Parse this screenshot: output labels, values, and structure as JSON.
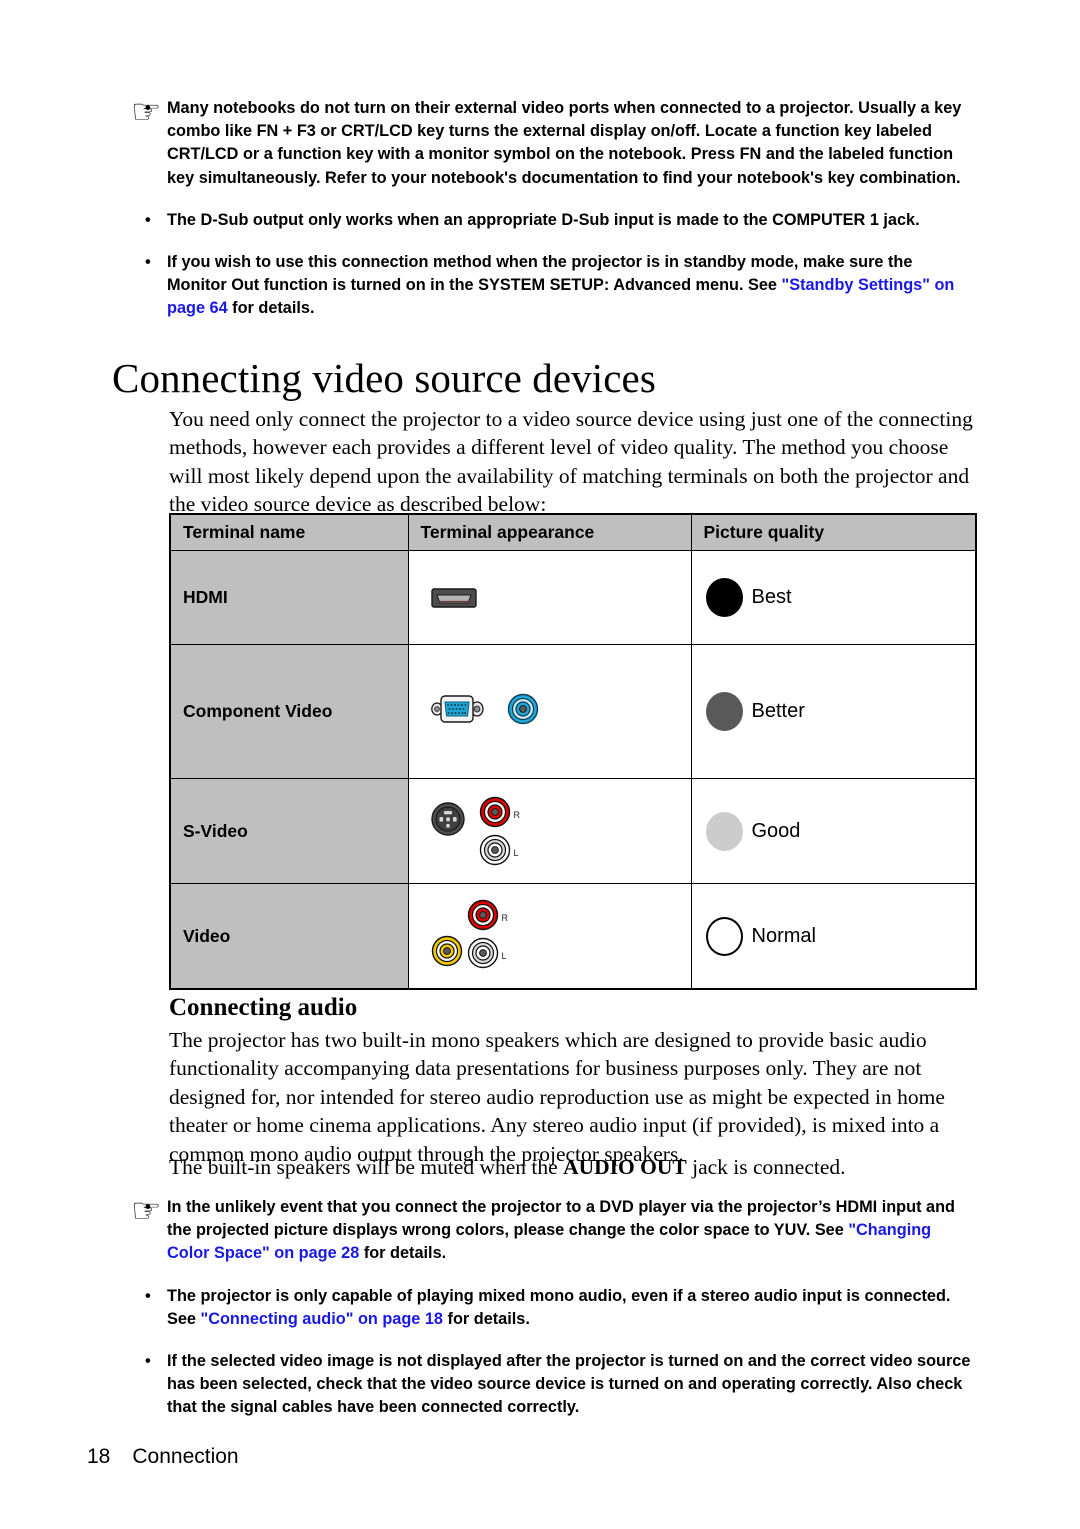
{
  "page": {
    "number": "18",
    "section": "Connection"
  },
  "icons": {
    "hand": "☞",
    "hdmi_port": "hdmi-port-icon",
    "dsub": "d-sub-connector-icon",
    "rca_blue": "rca-jack-blue-icon",
    "mini_din": "mini-din-s-video-icon",
    "rca_red": "rca-jack-red-icon",
    "rca_white": "rca-jack-white-icon",
    "rca_yellow": "rca-jack-yellow-icon"
  },
  "top_notes": {
    "items": [
      {
        "bullet": "•",
        "parts": [
          {
            "text": "Many notebooks do not turn on their external video ports when connected to a projector. Usually a key combo like FN + F3 or CRT/LCD key turns the external display on/off. Locate a function key labeled CRT/LCD or a function key with a monitor symbol on the notebook. Press FN and the labeled function key simultaneously. Refer to your notebook's documentation to find your notebook's key combination.",
            "style": "plain"
          }
        ]
      },
      {
        "bullet": "•",
        "parts": [
          {
            "text": "The D-Sub output only works when an appropriate D-Sub input is made to the COMPUTER 1 jack.",
            "style": "plain"
          }
        ]
      },
      {
        "bullet": "•",
        "parts": [
          {
            "text": "If you wish to use this connection method when the projector is in standby mode, make sure the Monitor Out function is turned on in the SYSTEM SETUP: Advanced menu. See ",
            "style": "plain"
          },
          {
            "text": "\"Standby Settings\" on page 64",
            "style": "link"
          },
          {
            "text": " for details.",
            "style": "plain"
          }
        ]
      }
    ]
  },
  "main": {
    "heading": "Connecting video source devices",
    "intro": "You need only connect the projector to a video source device using just one of the connecting methods, however each provides a different level of video quality. The method you choose will most likely depend upon the availability of matching terminals on both the projector and the video source device as described below:"
  },
  "table": {
    "headers": [
      "Terminal name",
      "Terminal appearance",
      "Picture quality"
    ],
    "rows": [
      {
        "name": "HDMI",
        "appearance_icons": [
          "hdmi_port"
        ],
        "quality_label": "Best",
        "quality_color": "#000000",
        "quality_border": "#000000"
      },
      {
        "name": "Component Video",
        "appearance_icons": [
          "dsub",
          "rca_blue"
        ],
        "quality_label": "Better",
        "quality_color": "#595959",
        "quality_border": "#595959"
      },
      {
        "name": "S-Video",
        "appearance_icons": [
          "mini_din",
          "rca_red",
          "rca_white"
        ],
        "quality_label": "Good",
        "quality_color": "#cccccc",
        "quality_border": "#cccccc"
      },
      {
        "name": "Video",
        "appearance_icons": [
          "rca_yellow",
          "rca_red",
          "rca_white"
        ],
        "quality_label": "Normal",
        "quality_color": "#ffffff",
        "quality_border": "#000000"
      }
    ],
    "rca_channel_labels": {
      "right": "R",
      "left": "L"
    }
  },
  "audio": {
    "heading": "Connecting audio",
    "paragraph": "The projector has two built-in mono speakers which are designed to provide basic audio functionality accompanying data presentations for business purposes only. They are not designed for, nor intended for stereo audio reproduction use as might be expected in home theater or home cinema applications. Any stereo audio input (if provided), is mixed into a common mono audio output through the projector speakers.",
    "muted_note_pre": "The built-in speakers will be muted when the ",
    "muted_note_bold": "AUDIO OUT",
    "muted_note_post": " jack is connected."
  },
  "bottom_notes": {
    "items": [
      {
        "bullet": "•",
        "parts": [
          {
            "text": "In the unlikely event that you connect the projector to a DVD player via the projector’s HDMI input and the projected picture displays wrong colors, please change the color space to YUV. See ",
            "style": "plain"
          },
          {
            "text": "\"Changing Color Space\" on page 28",
            "style": "link"
          },
          {
            "text": " for details.",
            "style": "plain"
          }
        ]
      },
      {
        "bullet": "•",
        "parts": [
          {
            "text": "The projector is only capable of playing mixed mono audio, even if a stereo audio input is connected. See ",
            "style": "plain"
          },
          {
            "text": "\"Connecting audio\" on page 18",
            "style": "link"
          },
          {
            "text": " for details.",
            "style": "plain"
          }
        ]
      },
      {
        "bullet": "•",
        "parts": [
          {
            "text": "If the selected video image is not displayed after the projector is turned on and the correct video source has been selected, check that the video source device is turned on and operating correctly. Also check that the signal cables have been connected correctly.",
            "style": "plain"
          }
        ]
      }
    ]
  }
}
